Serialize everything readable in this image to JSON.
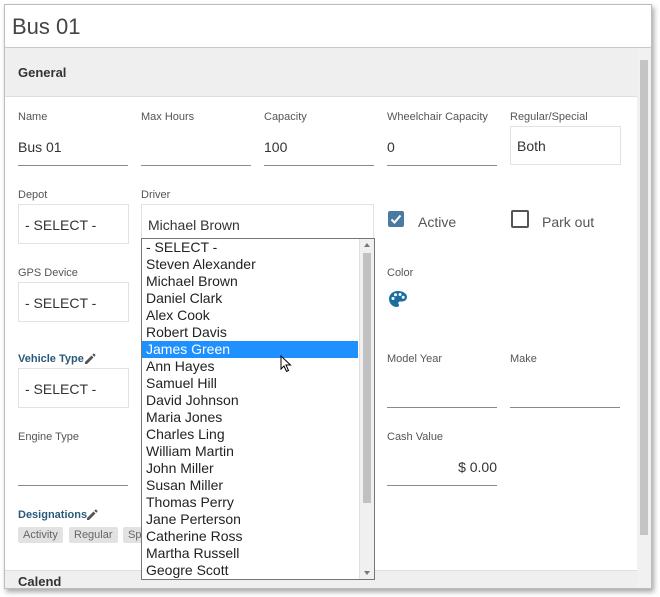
{
  "window": {
    "title": "Bus 01"
  },
  "general": {
    "title": "General",
    "name": {
      "label": "Name",
      "value": "Bus 01"
    },
    "max_hours": {
      "label": "Max Hours",
      "value": ""
    },
    "capacity": {
      "label": "Capacity",
      "value": "100"
    },
    "wheelchair_capacity": {
      "label": "Wheelchair Capacity",
      "value": "0"
    },
    "regular_special": {
      "label": "Regular/Special",
      "value": "Both"
    },
    "depot": {
      "label": "Depot",
      "value": "- SELECT -"
    },
    "driver": {
      "label": "Driver",
      "value": "Michael Brown"
    },
    "active": {
      "label": "Active",
      "checked": true
    },
    "park_out": {
      "label": "Park out",
      "checked": false
    },
    "gps_device": {
      "label": "GPS Device",
      "value": "- SELECT -"
    },
    "color": {
      "label": "Color",
      "icon": "palette-icon",
      "icon_color": "#1a6fa0"
    },
    "vehicle_type": {
      "label": "Vehicle Type",
      "value": "- SELECT -",
      "edit_icon": "pencil-icon"
    },
    "model_year": {
      "label": "Model Year",
      "value": ""
    },
    "make": {
      "label": "Make",
      "value": ""
    },
    "engine_type": {
      "label": "Engine Type",
      "value": ""
    },
    "cash_value": {
      "label": "Cash Value",
      "value": "$ 0.00"
    },
    "designations": {
      "label": "Designations",
      "edit_icon": "pencil-icon",
      "chips": [
        "Activity",
        "Regular",
        "Spe"
      ]
    },
    "next_section_partial": "Calend"
  },
  "driver_dropdown": {
    "options": [
      "- SELECT -",
      "Steven Alexander",
      "Michael Brown",
      "Daniel Clark",
      "Alex Cook",
      "Robert Davis",
      "James Green",
      "Ann Hayes",
      "Samuel Hill",
      "David Johnson",
      "Maria Jones",
      "Charles Ling",
      "William Martin",
      "John Miller",
      "Susan Miller",
      "Thomas Perry",
      "Jane Perterson",
      "Catherine Ross",
      "Martha Russell",
      "Geogre Scott"
    ],
    "highlighted": "James Green"
  },
  "colors": {
    "accent": "#4a7aa0",
    "highlight": "#1e90ff",
    "label_accent": "#2a5a7a"
  }
}
